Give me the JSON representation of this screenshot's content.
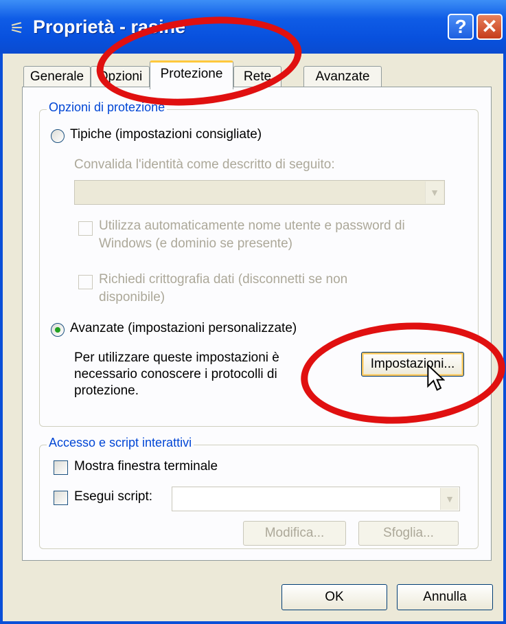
{
  "window": {
    "title": "Proprietà - rasine",
    "help_glyph": "?",
    "close_glyph": "✕"
  },
  "tabs": [
    {
      "label": "Generale"
    },
    {
      "label": "Opzioni"
    },
    {
      "label": "Protezione"
    },
    {
      "label": "Rete"
    },
    {
      "label": "Avanzate"
    }
  ],
  "security": {
    "legend": "Opzioni di protezione",
    "typical_label": "Tipiche (impostazioni consigliate)",
    "validate_label": "Convalida l'identità come descritto di seguito:",
    "validate_value": "",
    "auto_login_line1": "Utilizza automaticamente nome utente e password di",
    "auto_login_line2": "Windows (e dominio se presente)",
    "encrypt_line1": "Richiedi crittografia dati (disconnetti se non",
    "encrypt_line2": "disponibile)",
    "advanced_label": "Avanzate (impostazioni personalizzate)",
    "advanced_desc_line1": "Per utilizzare queste impostazioni è",
    "advanced_desc_line2": "necessario conoscere i protocolli di",
    "advanced_desc_line3": "protezione.",
    "settings_button": "Impostazioni..."
  },
  "scripting": {
    "legend": "Accesso e script interattivi",
    "terminal_label": "Mostra finestra terminale",
    "script_label": "Esegui script:",
    "script_value": "",
    "edit_button": "Modifica...",
    "browse_button": "Sfoglia..."
  },
  "footer": {
    "ok_button": "OK",
    "cancel_button": "Annulla"
  },
  "colors": {
    "titlebar": "#0a4fd8",
    "annotation": "#e01010",
    "legend": "#0046d5",
    "dialog_bg": "#ece9d8"
  },
  "selected": {
    "active_tab": "Protezione",
    "security_option": "advanced"
  }
}
